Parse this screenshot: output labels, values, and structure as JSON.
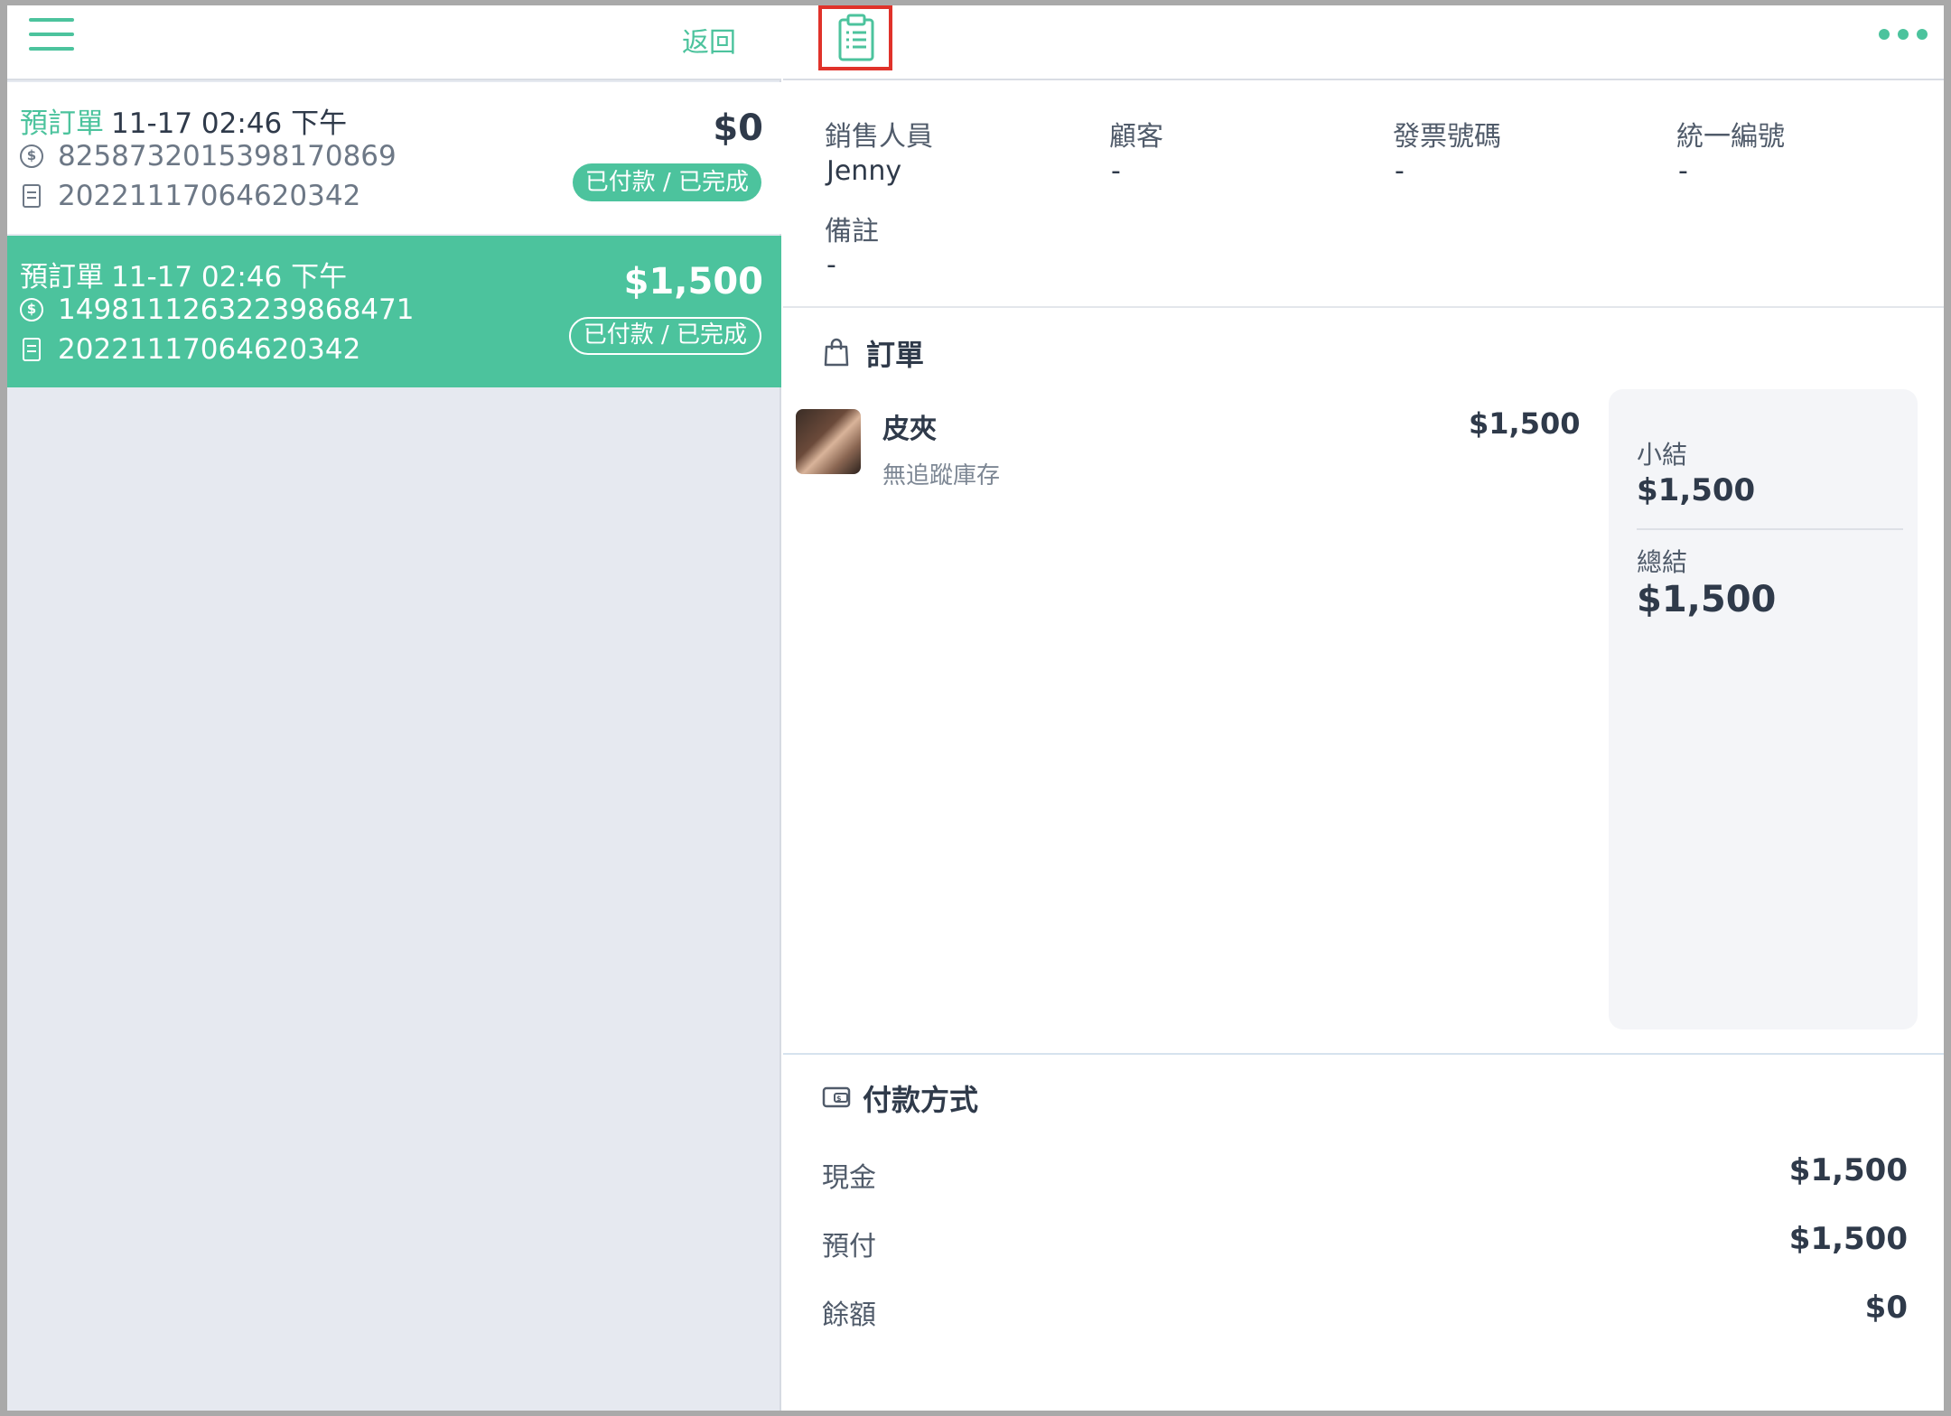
{
  "sidebar": {
    "back_label": "返回",
    "orders": [
      {
        "type": "預訂單",
        "datetime": "11-17 02:46 下午",
        "payment_id": "8258732015398170869",
        "receipt_no": "20221117064620342",
        "amount": "$0",
        "status": "已付款 / 已完成",
        "selected": false
      },
      {
        "type": "預訂單",
        "datetime": "11-17 02:46 下午",
        "payment_id": "14981112632239868471",
        "receipt_no": "20221117064620342",
        "amount": "$1,500",
        "status": "已付款 / 已完成",
        "selected": true
      }
    ]
  },
  "header": {
    "icon": "clipboard-icon",
    "menu_icon": "more-dots-icon"
  },
  "info": {
    "salesperson_label": "銷售人員",
    "salesperson_value": "Jenny",
    "customer_label": "顧客",
    "customer_value": "-",
    "invoice_label": "發票號碼",
    "invoice_value": "-",
    "tax_id_label": "統一編號",
    "tax_id_value": "-",
    "note_label": "備註",
    "note_value": "-"
  },
  "order": {
    "title": "訂單",
    "items": [
      {
        "name": "皮夾",
        "sub": "無追蹤庫存",
        "price": "$1,500"
      }
    ],
    "subtotal_label": "小結",
    "subtotal_value": "$1,500",
    "total_label": "總結",
    "total_value": "$1,500"
  },
  "payment": {
    "title": "付款方式",
    "rows": [
      {
        "label": "現金",
        "value": "$1,500"
      },
      {
        "label": "預付",
        "value": "$1,500"
      },
      {
        "label": "餘額",
        "value": "$0"
      }
    ]
  },
  "colors": {
    "accent": "#4cc39d",
    "highlight_box": "#e0322a",
    "text": "#2f3a4a",
    "sidebar_bg": "#e6e9f0"
  }
}
